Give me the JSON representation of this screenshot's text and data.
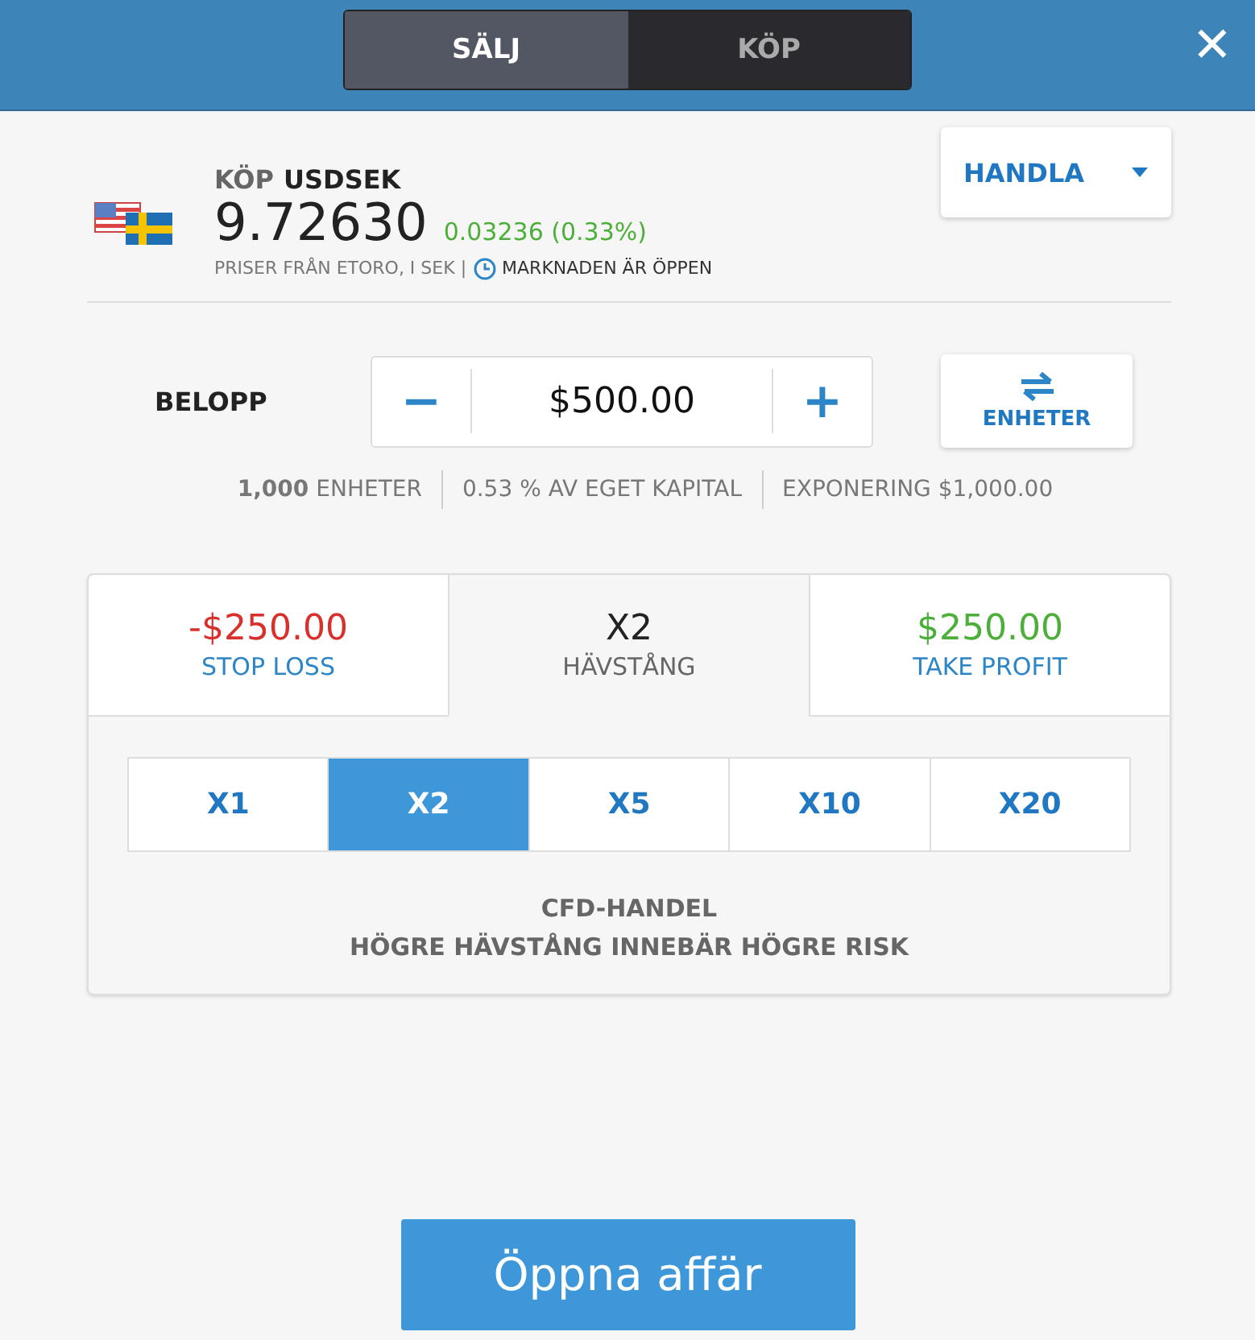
{
  "header": {
    "tabs": [
      {
        "label": "SÄLJ",
        "selected": true
      },
      {
        "label": "KÖP",
        "selected": false
      }
    ],
    "close": "✕"
  },
  "instrument": {
    "action": "KÖP",
    "symbol": "USDSEK",
    "price": "9.72630",
    "change": "0.03236 (0.33%)",
    "source": "PRISER FRÅN ETORO, I SEK |",
    "market": "MARKNADEN ÄR ÖPPEN",
    "menu": "HANDLA"
  },
  "amount": {
    "label": "BELOPP",
    "minus": "−",
    "value": "$500.00",
    "plus": "+",
    "units_button": "ENHETER"
  },
  "info": [
    "**1,000** ENHETER",
    "0.53 % AV EGET KAPITAL",
    "EXPONERING $1,000.00"
  ],
  "tabs": [
    {
      "value": "-$250.00",
      "label": "STOP LOSS",
      "color": "#d9302c",
      "selected": false
    },
    {
      "value": "X2",
      "label": "HÄVSTÅNG",
      "color": "#222222",
      "selected": true
    },
    {
      "value": "$250.00",
      "label": "TAKE PROFIT",
      "color": "#4caf3a",
      "selected": false
    }
  ],
  "leverage": [
    {
      "label": "X1",
      "selected": false
    },
    {
      "label": "X2",
      "selected": true
    },
    {
      "label": "X5",
      "selected": false
    },
    {
      "label": "X10",
      "selected": false
    },
    {
      "label": "X20",
      "selected": false
    }
  ],
  "notice": [
    "CFD-HANDEL",
    "HÖGRE HÄVSTÅNG INNEBÄR HÖGRE RISK"
  ],
  "submit": "Öppna affär"
}
